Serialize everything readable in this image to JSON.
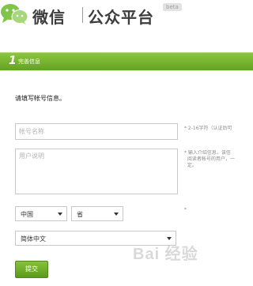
{
  "header": {
    "title": "微信",
    "subtitle": "公众平台",
    "badge": "beta"
  },
  "step": {
    "number": "1",
    "label": "完善信息"
  },
  "form": {
    "heading": "请填写帐号信息。",
    "name_placeholder": "帐号名称",
    "name_hint": "2-16字符（认证后可",
    "intro_placeholder": "用户说明",
    "intro_hint": [
      "输入介绍信息，该信",
      "阅读者帐号的用户，一",
      "定。"
    ],
    "country": "中国",
    "province": "省",
    "required_mark": "*",
    "language": "简体中文",
    "submit_label": "提交"
  },
  "watermark": "Bai 经验",
  "colors": {
    "accent_green": "#6aab27",
    "logo_green": "#7ec54a"
  },
  "icons": {
    "logo": "wechat-logo"
  }
}
